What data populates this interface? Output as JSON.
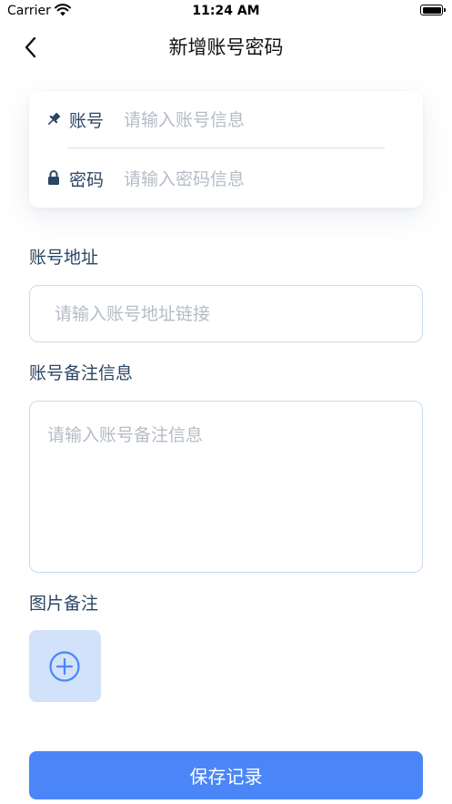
{
  "status_bar": {
    "carrier": "Carrier",
    "time": "11:24 AM"
  },
  "nav": {
    "title": "新增账号密码",
    "back_icon": "chevron-left-icon"
  },
  "credentials": {
    "account": {
      "label": "账号",
      "placeholder": "请输入账号信息",
      "icon": "pin-icon"
    },
    "password": {
      "label": "密码",
      "placeholder": "请输入密码信息",
      "icon": "lock-icon"
    }
  },
  "account_url": {
    "label": "账号地址",
    "placeholder": "请输入账号地址链接"
  },
  "account_note": {
    "label": "账号备注信息",
    "placeholder": "请输入账号备注信息"
  },
  "image_note": {
    "label": "图片备注",
    "add_icon": "plus-circle-icon"
  },
  "save_button": {
    "label": "保存记录"
  },
  "colors": {
    "accent": "#4a86f7",
    "add_tile_bg": "#d3e2fb",
    "label_text": "#2b4664",
    "placeholder": "#b5bcc6"
  }
}
